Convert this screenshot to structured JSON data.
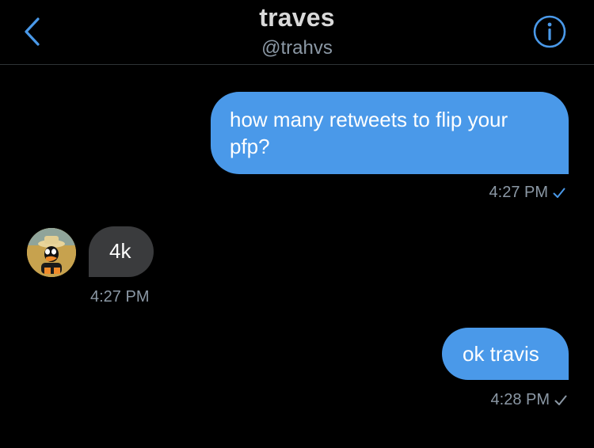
{
  "header": {
    "title": "traves",
    "handle": "@trahvs",
    "back_icon": "chevron-left-icon",
    "info_icon": "info-circle-icon"
  },
  "messages": [
    {
      "direction": "outgoing",
      "text": "how many retweets to flip your pfp?",
      "time": "4:27 PM",
      "status": "read"
    },
    {
      "direction": "incoming",
      "text": "4k",
      "time": "4:27 PM"
    },
    {
      "direction": "outgoing",
      "text": "ok travis",
      "time": "4:28 PM",
      "status": "sent"
    }
  ],
  "colors": {
    "background": "#000000",
    "accent": "#4a99e9",
    "incoming_bubble": "#3a3b3d",
    "muted_text": "#8b98a5"
  }
}
